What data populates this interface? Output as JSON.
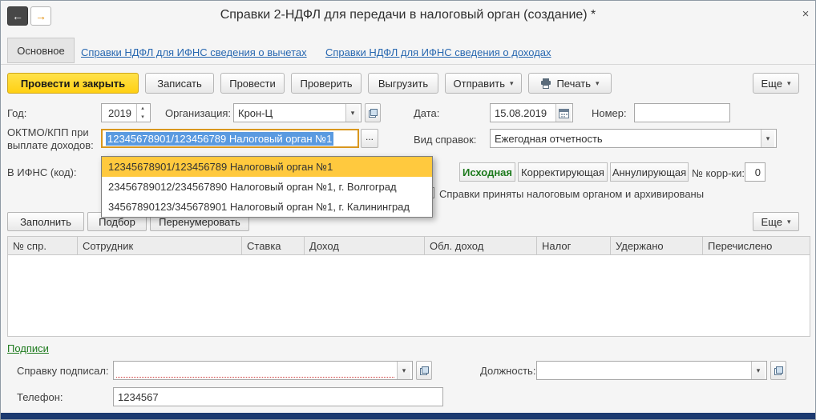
{
  "colors": {
    "primary_button_yellow": "#ffd013",
    "dropdown_highlight": "#ffc93e",
    "selection_blue": "#5a9ae0",
    "link_blue": "#2767b0",
    "section_green": "#1d7a1d",
    "bottom_strip_navy": "#1c3a70"
  },
  "icons": {
    "back": "←",
    "forward": "→",
    "close": "×",
    "caret_down": "▾",
    "spinner_up": "▴",
    "spinner_down": "▾",
    "ellipsis": "..."
  },
  "window": {
    "title": "Справки 2-НДФЛ для передачи в налоговый орган (создание) *"
  },
  "nav": {
    "tab_main": "Основное",
    "link_deductions": "Справки НДФЛ для ИФНС сведения о вычетах",
    "link_incomes": "Справки НДФЛ для ИФНС сведения о доходах"
  },
  "toolbar": {
    "post_and_close": "Провести и закрыть",
    "write": "Записать",
    "post": "Провести",
    "check": "Проверить",
    "unload": "Выгрузить",
    "send": "Отправить",
    "print": "Печать",
    "more": "Еще"
  },
  "fields": {
    "year": {
      "label": "Год:",
      "value": "2019"
    },
    "organization": {
      "label": "Организация:",
      "value": "Крон-Ц"
    },
    "date": {
      "label": "Дата:",
      "value": "15.08.2019"
    },
    "number": {
      "label": "Номер:",
      "value": ""
    },
    "oktmo": {
      "label_line1": "ОКТМО/КПП при",
      "label_line2": "выплате доходов:",
      "value": "12345678901/123456789 Налоговый орган №1"
    },
    "kind": {
      "label": "Вид справок:",
      "value": "Ежегодная отчетность"
    },
    "ifns": {
      "label": "В ИФНС (код):",
      "value": ""
    },
    "correction_no": {
      "label": "№ корр-ки:",
      "value": "0"
    },
    "archived_checkbox": "Справки приняты налоговым органом и архивированы"
  },
  "type_switch": {
    "original": "Исходная",
    "correcting": "Корректирующая",
    "cancelling": "Аннулирующая"
  },
  "oktmo_dropdown": {
    "selected_index": 0,
    "items": [
      "12345678901/123456789 Налоговый орган №1",
      "23456789012/234567890 Налоговый орган №1, г. Волгоград",
      "34567890123/345678901 Налоговый орган №1, г. Калининград"
    ]
  },
  "table": {
    "buttons": {
      "fill": "Заполнить",
      "pick": "Подбор",
      "renumber": "Перенумеровать",
      "more": "Еще"
    },
    "headers": [
      "№ спр.",
      "Сотрудник",
      "Ставка",
      "Доход",
      "Обл. доход",
      "Налог",
      "Удержано",
      "Перечислено"
    ],
    "rows": []
  },
  "signatures": {
    "section_title": "Подписи",
    "signed_by": {
      "label": "Справку подписал:",
      "value": ""
    },
    "position": {
      "label": "Должность:",
      "value": ""
    },
    "phone": {
      "label": "Телефон:",
      "value": "1234567"
    }
  }
}
